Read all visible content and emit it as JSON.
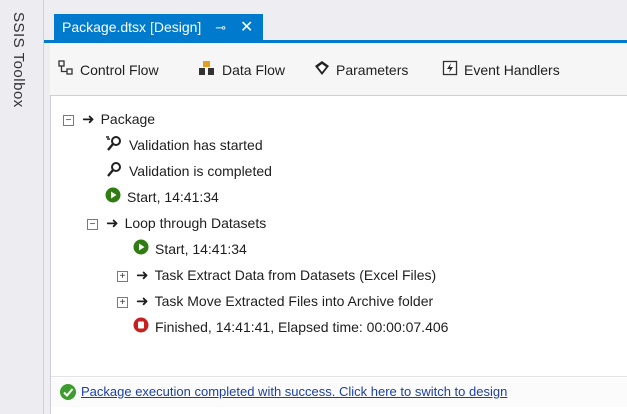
{
  "toolbox": {
    "label": "SSIS Toolbox"
  },
  "document_tab": {
    "title": "Package.dtsx [Design]",
    "pin_glyph": "⊸",
    "close_glyph": "✕"
  },
  "designer_tabs": [
    {
      "label": "Control Flow",
      "icon": "control-flow-icon"
    },
    {
      "label": "Data Flow",
      "icon": "data-flow-icon"
    },
    {
      "label": "Parameters",
      "icon": "parameters-icon"
    },
    {
      "label": "Event Handlers",
      "icon": "event-handlers-icon"
    }
  ],
  "progress": {
    "items": [
      {
        "text": "Package",
        "icon": "arrow-icon",
        "expander": "−"
      },
      {
        "text": "Validation has started",
        "icon": "validation-started-icon"
      },
      {
        "text": "Validation is completed",
        "icon": "validation-completed-icon"
      },
      {
        "text": "Start, 14:41:34",
        "icon": "start-icon"
      },
      {
        "text": "Loop through Datasets",
        "icon": "arrow-icon",
        "expander": "−"
      },
      {
        "text": "Start, 14:41:34",
        "icon": "start-icon"
      },
      {
        "text": "Task Extract Data from Datasets (Excel Files)",
        "icon": "arrow-icon",
        "expander": "+"
      },
      {
        "text": "Task Move Extracted Files into Archive folder",
        "icon": "arrow-icon",
        "expander": "+"
      },
      {
        "text": "Finished, 14:41:41, Elapsed time: 00:00:07.406",
        "icon": "finished-icon"
      }
    ]
  },
  "status": {
    "message": "Package execution completed with success. Click here to switch to design",
    "icon": "success-check-icon",
    "colors": {
      "accent": "#007acc",
      "success": "#3c9d2c",
      "start": "#2f7d12",
      "finished": "#c62020"
    }
  }
}
